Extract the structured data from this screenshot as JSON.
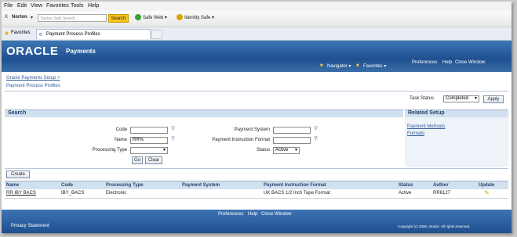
{
  "browser": {
    "menu": [
      "File",
      "Edit",
      "View",
      "Favorites",
      "Tools",
      "Help"
    ],
    "close_x": "X",
    "norton_label": "Norton",
    "norton_dropdown": "▾",
    "search_placeholder": "Norton Safe Search",
    "search_button": "Search",
    "safe_web": "Safe Web ▾",
    "identity_safe": "Identity Safe ▾",
    "favorites": "Favorites",
    "tab_title": "Payment Process Profiles"
  },
  "header": {
    "logo": "ORACLE",
    "app_name": "Payments",
    "navigator": "Navigator ▾",
    "favorites": "Favorites ▾",
    "links": [
      "Preferences",
      "Help",
      "Close Window"
    ]
  },
  "breadcrumb": "Oracle Payments Setup >",
  "page_title": "Payment Process Profiles",
  "task_status": {
    "label": "Task Status",
    "value": "Completed",
    "apply": "Apply"
  },
  "search": {
    "title": "Search",
    "code_label": "Code",
    "code_value": "",
    "name_label": "Name",
    "name_value": "RR%",
    "processing_type_label": "Processing Type",
    "processing_type_value": "",
    "payment_system_label": "Payment System",
    "payment_system_value": "",
    "instruction_format_label": "Payment Instruction Format",
    "instruction_format_value": "",
    "status_label": "Status",
    "status_value": "Active",
    "go": "Go",
    "clear": "Clear"
  },
  "related": {
    "title": "Related Setup",
    "links": [
      "Payment Methods",
      "Formats"
    ]
  },
  "results": {
    "create": "Create",
    "columns": [
      "Name",
      "Code",
      "Processing Type",
      "Payment System",
      "Payment Instruction Format",
      "Status",
      "Author",
      "Update"
    ],
    "rows": [
      {
        "name": "RR IBY BACS",
        "code": "IBY_BACS",
        "processing_type": "Electronic",
        "payment_system": "",
        "format": "UK BACS 1/2 Inch Tape Format",
        "status": "Active",
        "author": "RR6127"
      }
    ]
  },
  "footer": {
    "links": [
      "Preferences",
      "Help",
      "Close Window"
    ],
    "privacy": "Privacy Statement",
    "copyright": "Copyright (c) 2006, Oracle. All rights reserved."
  },
  "colors": {
    "header_blue": "#1f4f8f",
    "section_bg": "#d2e1f0",
    "link": "#335b9c"
  }
}
